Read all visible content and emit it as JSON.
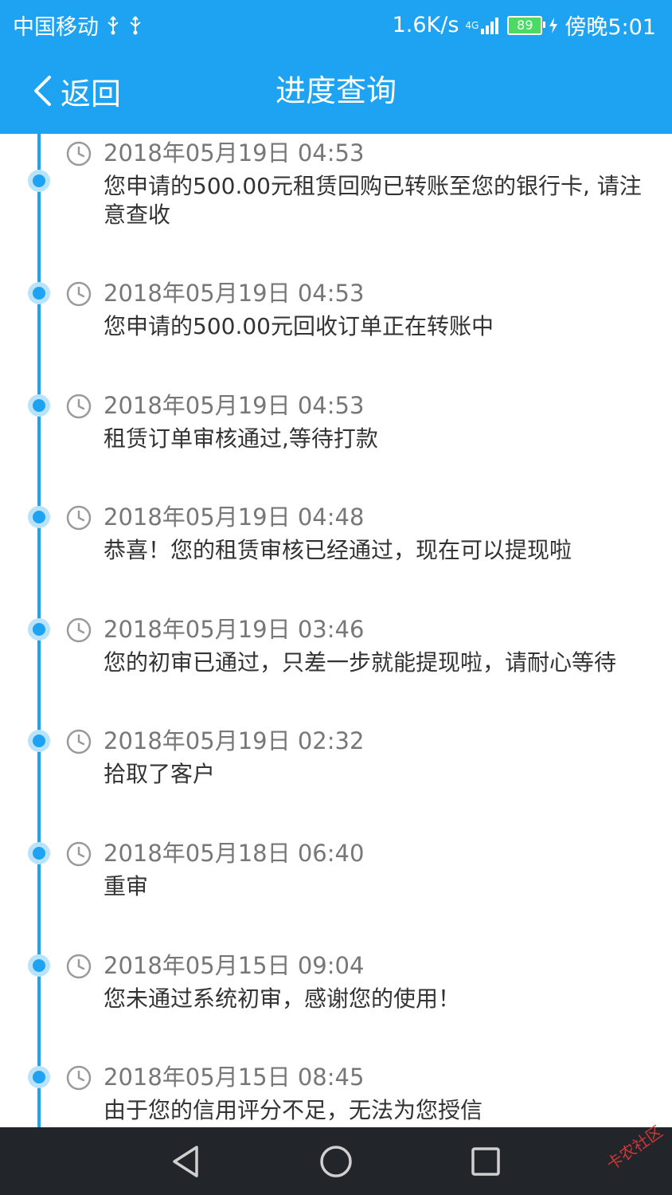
{
  "status_bar": {
    "carrier": "中国移动",
    "speed": "1.6K/s",
    "network": "4G",
    "battery": "89",
    "time": "傍晚5:01"
  },
  "header": {
    "back_label": "返回",
    "title": "进度查询"
  },
  "timeline": [
    {
      "time": "2018年05月19日 04:53",
      "text": "您申请的500.00元租赁回购已转账至您的银行卡, 请注意查收"
    },
    {
      "time": "2018年05月19日 04:53",
      "text": "您申请的500.00元回收订单正在转账中"
    },
    {
      "time": "2018年05月19日 04:53",
      "text": "租赁订单审核通过,等待打款"
    },
    {
      "time": "2018年05月19日 04:48",
      "text": "恭喜！您的租赁审核已经通过，现在可以提现啦"
    },
    {
      "time": "2018年05月19日 03:46",
      "text": "您的初审已通过，只差一步就能提现啦，请耐心等待"
    },
    {
      "time": "2018年05月19日 02:32",
      "text": "拾取了客户"
    },
    {
      "time": "2018年05月18日 06:40",
      "text": "重审"
    },
    {
      "time": "2018年05月15日 09:04",
      "text": "您未通过系统初审，感谢您的使用！"
    },
    {
      "time": "2018年05月15日 08:45",
      "text": "由于您的信用评分不足，无法为您授信"
    }
  ],
  "watermark": "卡农社区",
  "colors": {
    "accent": "#1ea3f2",
    "time_text": "#777777",
    "body_text": "#333333",
    "navbar": "#22252a"
  },
  "icons": {
    "back": "chevron-left-icon",
    "clock": "clock-icon",
    "nav_back": "triangle-back-icon",
    "nav_home": "circle-home-icon",
    "nav_recent": "square-recent-icon"
  }
}
